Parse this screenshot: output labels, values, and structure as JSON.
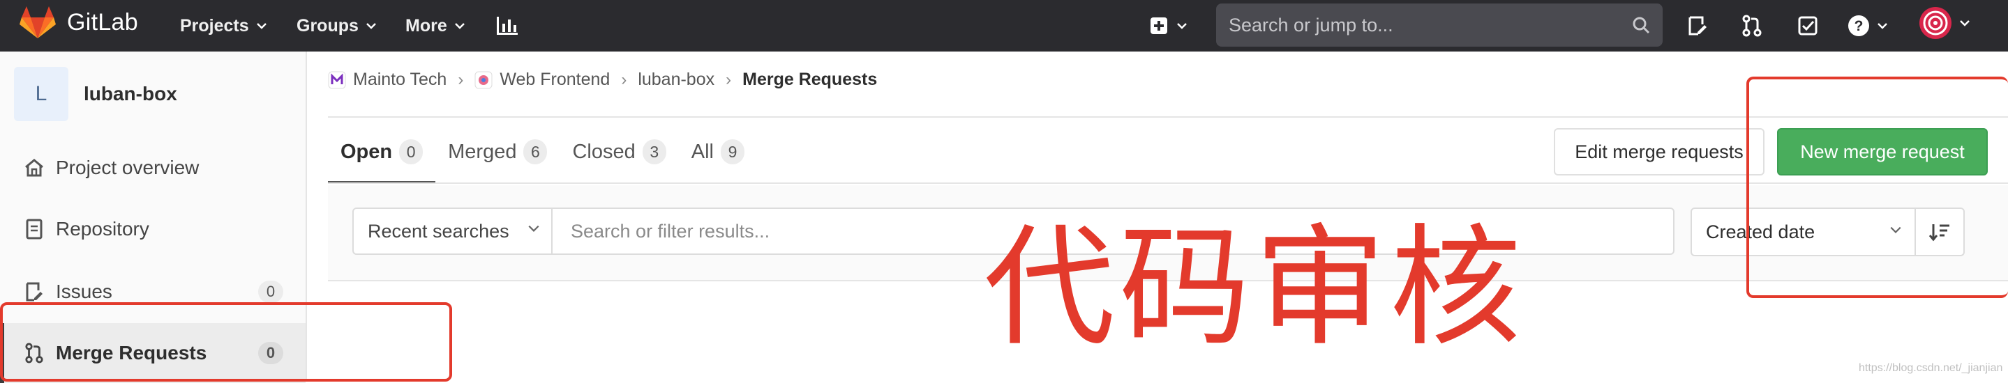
{
  "topnav": {
    "brand": "GitLab",
    "links": [
      {
        "label": "Projects"
      },
      {
        "label": "Groups"
      },
      {
        "label": "More"
      }
    ],
    "search_placeholder": "Search or jump to..."
  },
  "sidebar": {
    "avatar_letter": "L",
    "project_name": "luban-box",
    "items": [
      {
        "label": "Project overview",
        "icon": "home-icon"
      },
      {
        "label": "Repository",
        "icon": "document-icon"
      },
      {
        "label": "Issues",
        "icon": "issues-icon",
        "count": "0"
      },
      {
        "label": "Merge Requests",
        "icon": "merge-request-icon",
        "count": "0",
        "active": true
      }
    ]
  },
  "breadcrumb": [
    {
      "label": "Mainto Tech"
    },
    {
      "label": "Web Frontend"
    },
    {
      "label": "luban-box"
    },
    {
      "label": "Merge Requests"
    }
  ],
  "tabs": [
    {
      "label": "Open",
      "count": "0",
      "active": true
    },
    {
      "label": "Merged",
      "count": "6"
    },
    {
      "label": "Closed",
      "count": "3"
    },
    {
      "label": "All",
      "count": "9"
    }
  ],
  "buttons": {
    "edit": "Edit merge requests",
    "new": "New merge request"
  },
  "filter": {
    "recent_searches": "Recent searches",
    "placeholder": "Search or filter results...",
    "sort": "Created date"
  },
  "annotation": {
    "text": "代码审核",
    "color": "#e33a2c"
  },
  "watermark": "https://blog.csdn.net/_jianjian",
  "colors": {
    "nav_bg": "#2b2b2f",
    "primary_green": "#49ad5c",
    "annotation_red": "#e33a2c"
  }
}
